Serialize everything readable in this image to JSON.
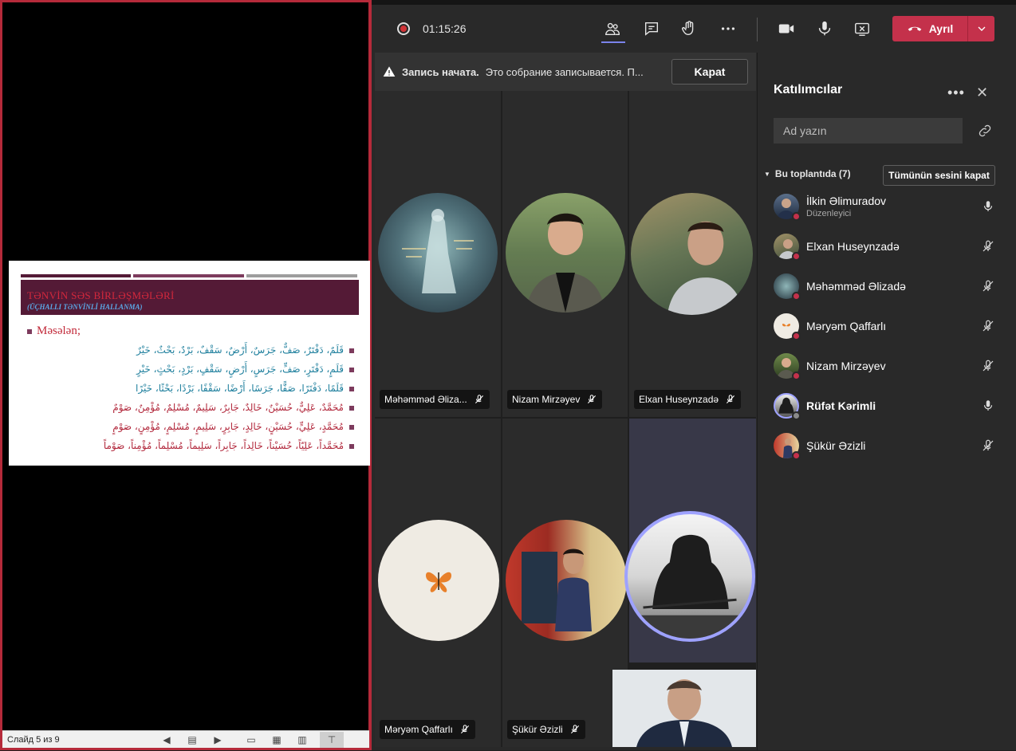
{
  "powerpoint": {
    "slide": {
      "title": "TƏNVİN SƏS BİRLƏŞMƏLƏRİ",
      "subtitle": "(ÜÇHALLI TƏNVİNLİ HALLANMA)",
      "example_label": "Məsələn;",
      "arabic_lines": [
        {
          "text": "قَلَمٌ، دَفْتَرٌ، صَفٌّ، جَرَسٌ، أَرْضٌ، سَقْفٌ، بَرْدٌ، بَحْثٌ، خَيْرٌ",
          "color": "#1e7f9d"
        },
        {
          "text": "قَلَمٍ، دَفْتَرٍ، صَفٍّ، جَرَسٍ، أَرْضٍ، سَقْفٍ، بَرْدٍ، بَحْثٍ، خَيْرٍ",
          "color": "#1e7f9d"
        },
        {
          "text": "قَلَمًا، دَفْتَرًا، صَفًّا، جَرَسًا، أَرْضًا، سَقْفًا، بَرْدًا، بَحْثًا، خَيْرًا",
          "color": "#1e7f9d"
        },
        {
          "text": "مُحَمَّدٌ، عَلِيٌّ، حُسَيْنٌ، خَالِدٌ، جَابِرٌ، سَلِيمٌ، مُسْلِمٌ، مُؤْمِنٌ، صَوْمٌ",
          "color": "#b2283c"
        },
        {
          "text": "مُحَمَّدٍ، عَلِيٍّ، حُسَيْنٍ، خَالِدٍ، جَابِرٍ، سَلِيمٍ، مُسْلِمٍ، مُؤْمِنٍ، صَوْمٍ",
          "color": "#b2283c"
        },
        {
          "text": "مُحَمَّداً، عَلِيّاً، حُسَيْناً، خَالِداً، جَابِراً، سَلِيماً، مُسْلِماً، مُؤْمِناً، صَوْماً",
          "color": "#b2283c"
        }
      ]
    },
    "status": {
      "slide_counter": "Слайд 5 из 9"
    }
  },
  "teams": {
    "toolbar": {
      "timer": "01:15:26",
      "leave_label": "Ayrıl"
    },
    "recording_banner": {
      "strong": "Запись начата.",
      "message": "Это собрание записывается. П...",
      "close_label": "Kapat"
    },
    "tiles": [
      {
        "name": "Məhəmməd Əliza..."
      },
      {
        "name": "Nizam Mirzəyev"
      },
      {
        "name": "Elxan Huseynzadə"
      },
      {
        "name": "Məryəm Qaffarlı"
      },
      {
        "name": "Şükür Əzizli"
      }
    ],
    "panel": {
      "title": "Katılımcılar",
      "search_placeholder": "Ad yazın",
      "section_label": "Bu toplantıda (7)",
      "mute_all_label": "Tümünün sesini kapat",
      "participants": [
        {
          "name": "İlkin Əlimuradov",
          "role": "Düzenleyici",
          "mic": "on"
        },
        {
          "name": "Elxan Huseynzadə",
          "mic": "off"
        },
        {
          "name": "Məhəmməd Əlizadə",
          "mic": "off"
        },
        {
          "name": "Məryəm Qaffarlı",
          "mic": "off"
        },
        {
          "name": "Nizam Mirzəyev",
          "mic": "off"
        },
        {
          "name": "Rüfət Kərimli",
          "mic": "on"
        },
        {
          "name": "Şükür Əzizli",
          "mic": "off"
        }
      ]
    },
    "colors": {
      "leave_red": "#c4314b",
      "accent": "#7b83eb",
      "status_red": "#d13438"
    }
  }
}
